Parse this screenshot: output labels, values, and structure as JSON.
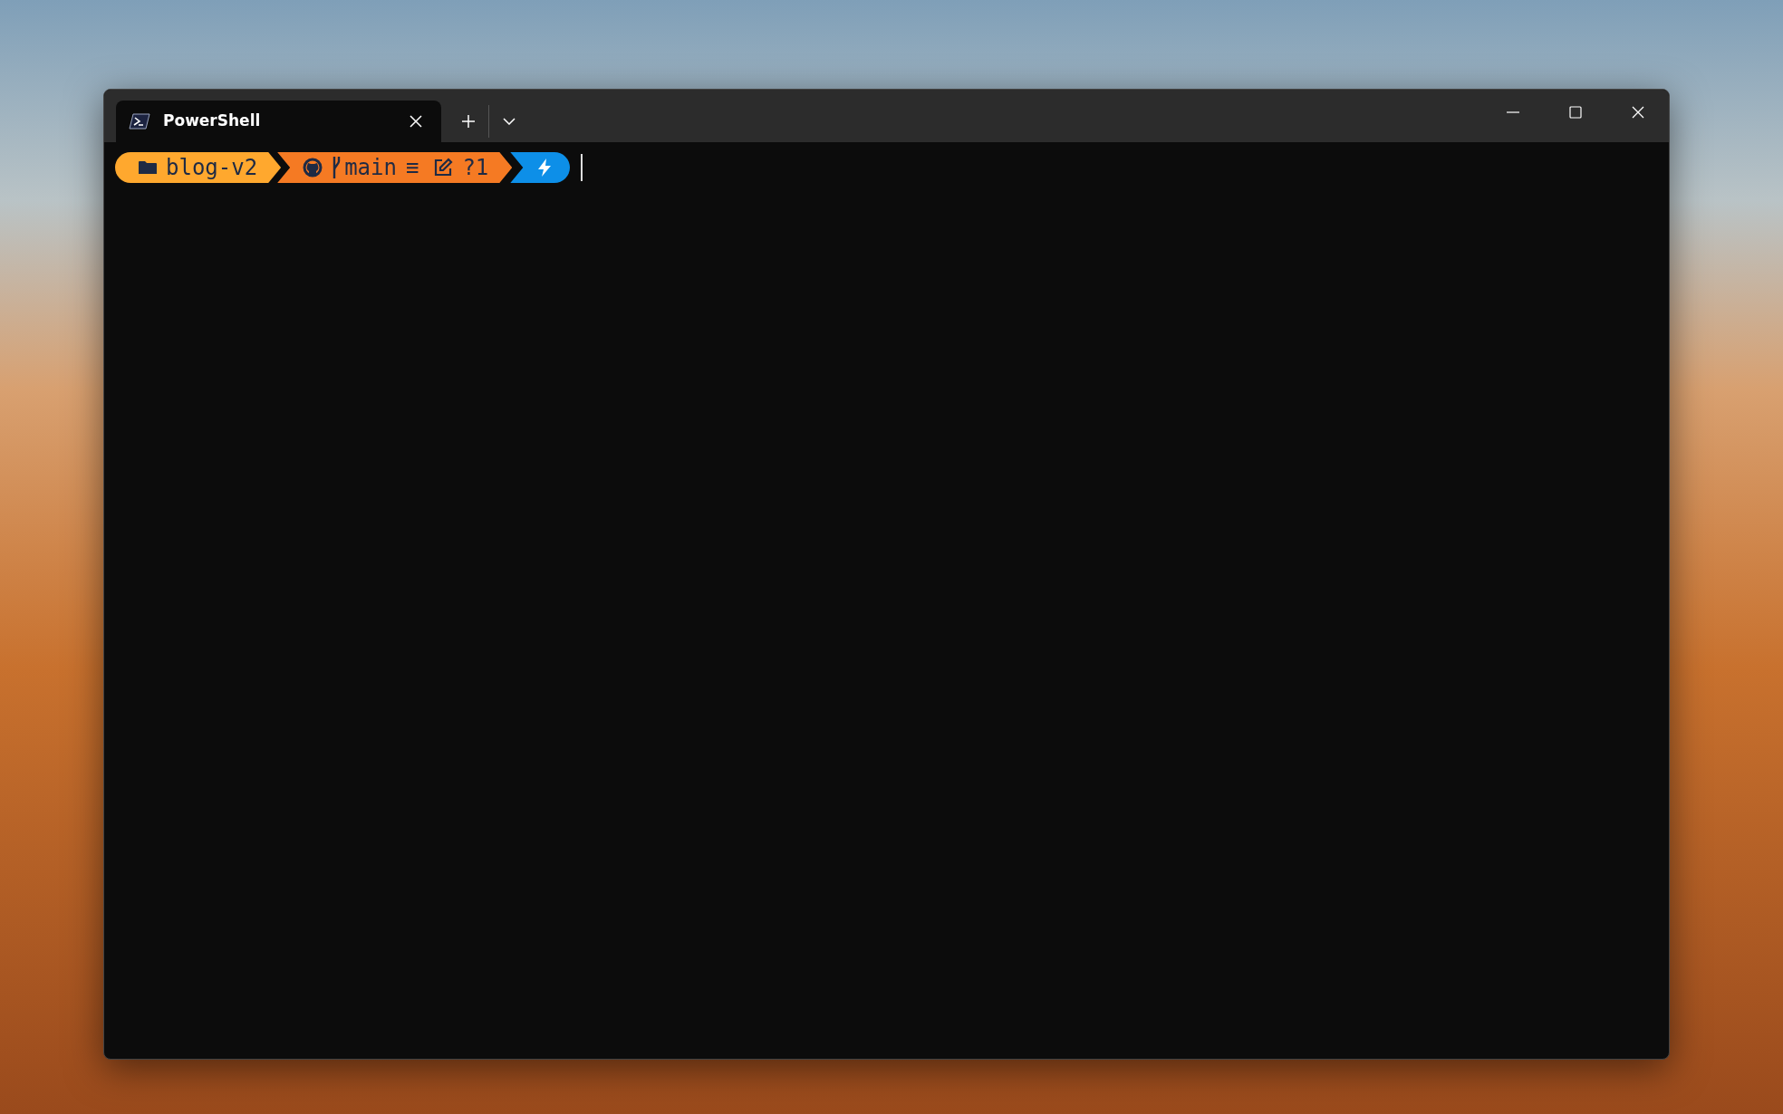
{
  "tabs": [
    {
      "label": "PowerShell",
      "selected": true
    }
  ],
  "prompt": {
    "segments": [
      {
        "kind": "path",
        "text": "blog-v2",
        "color": "#ffa82e"
      },
      {
        "kind": "git",
        "branch": "main",
        "status_symbol": "≡",
        "changes": "?1",
        "color": "#f57a23"
      },
      {
        "kind": "shell",
        "color": "#0d8fe8"
      }
    ]
  }
}
